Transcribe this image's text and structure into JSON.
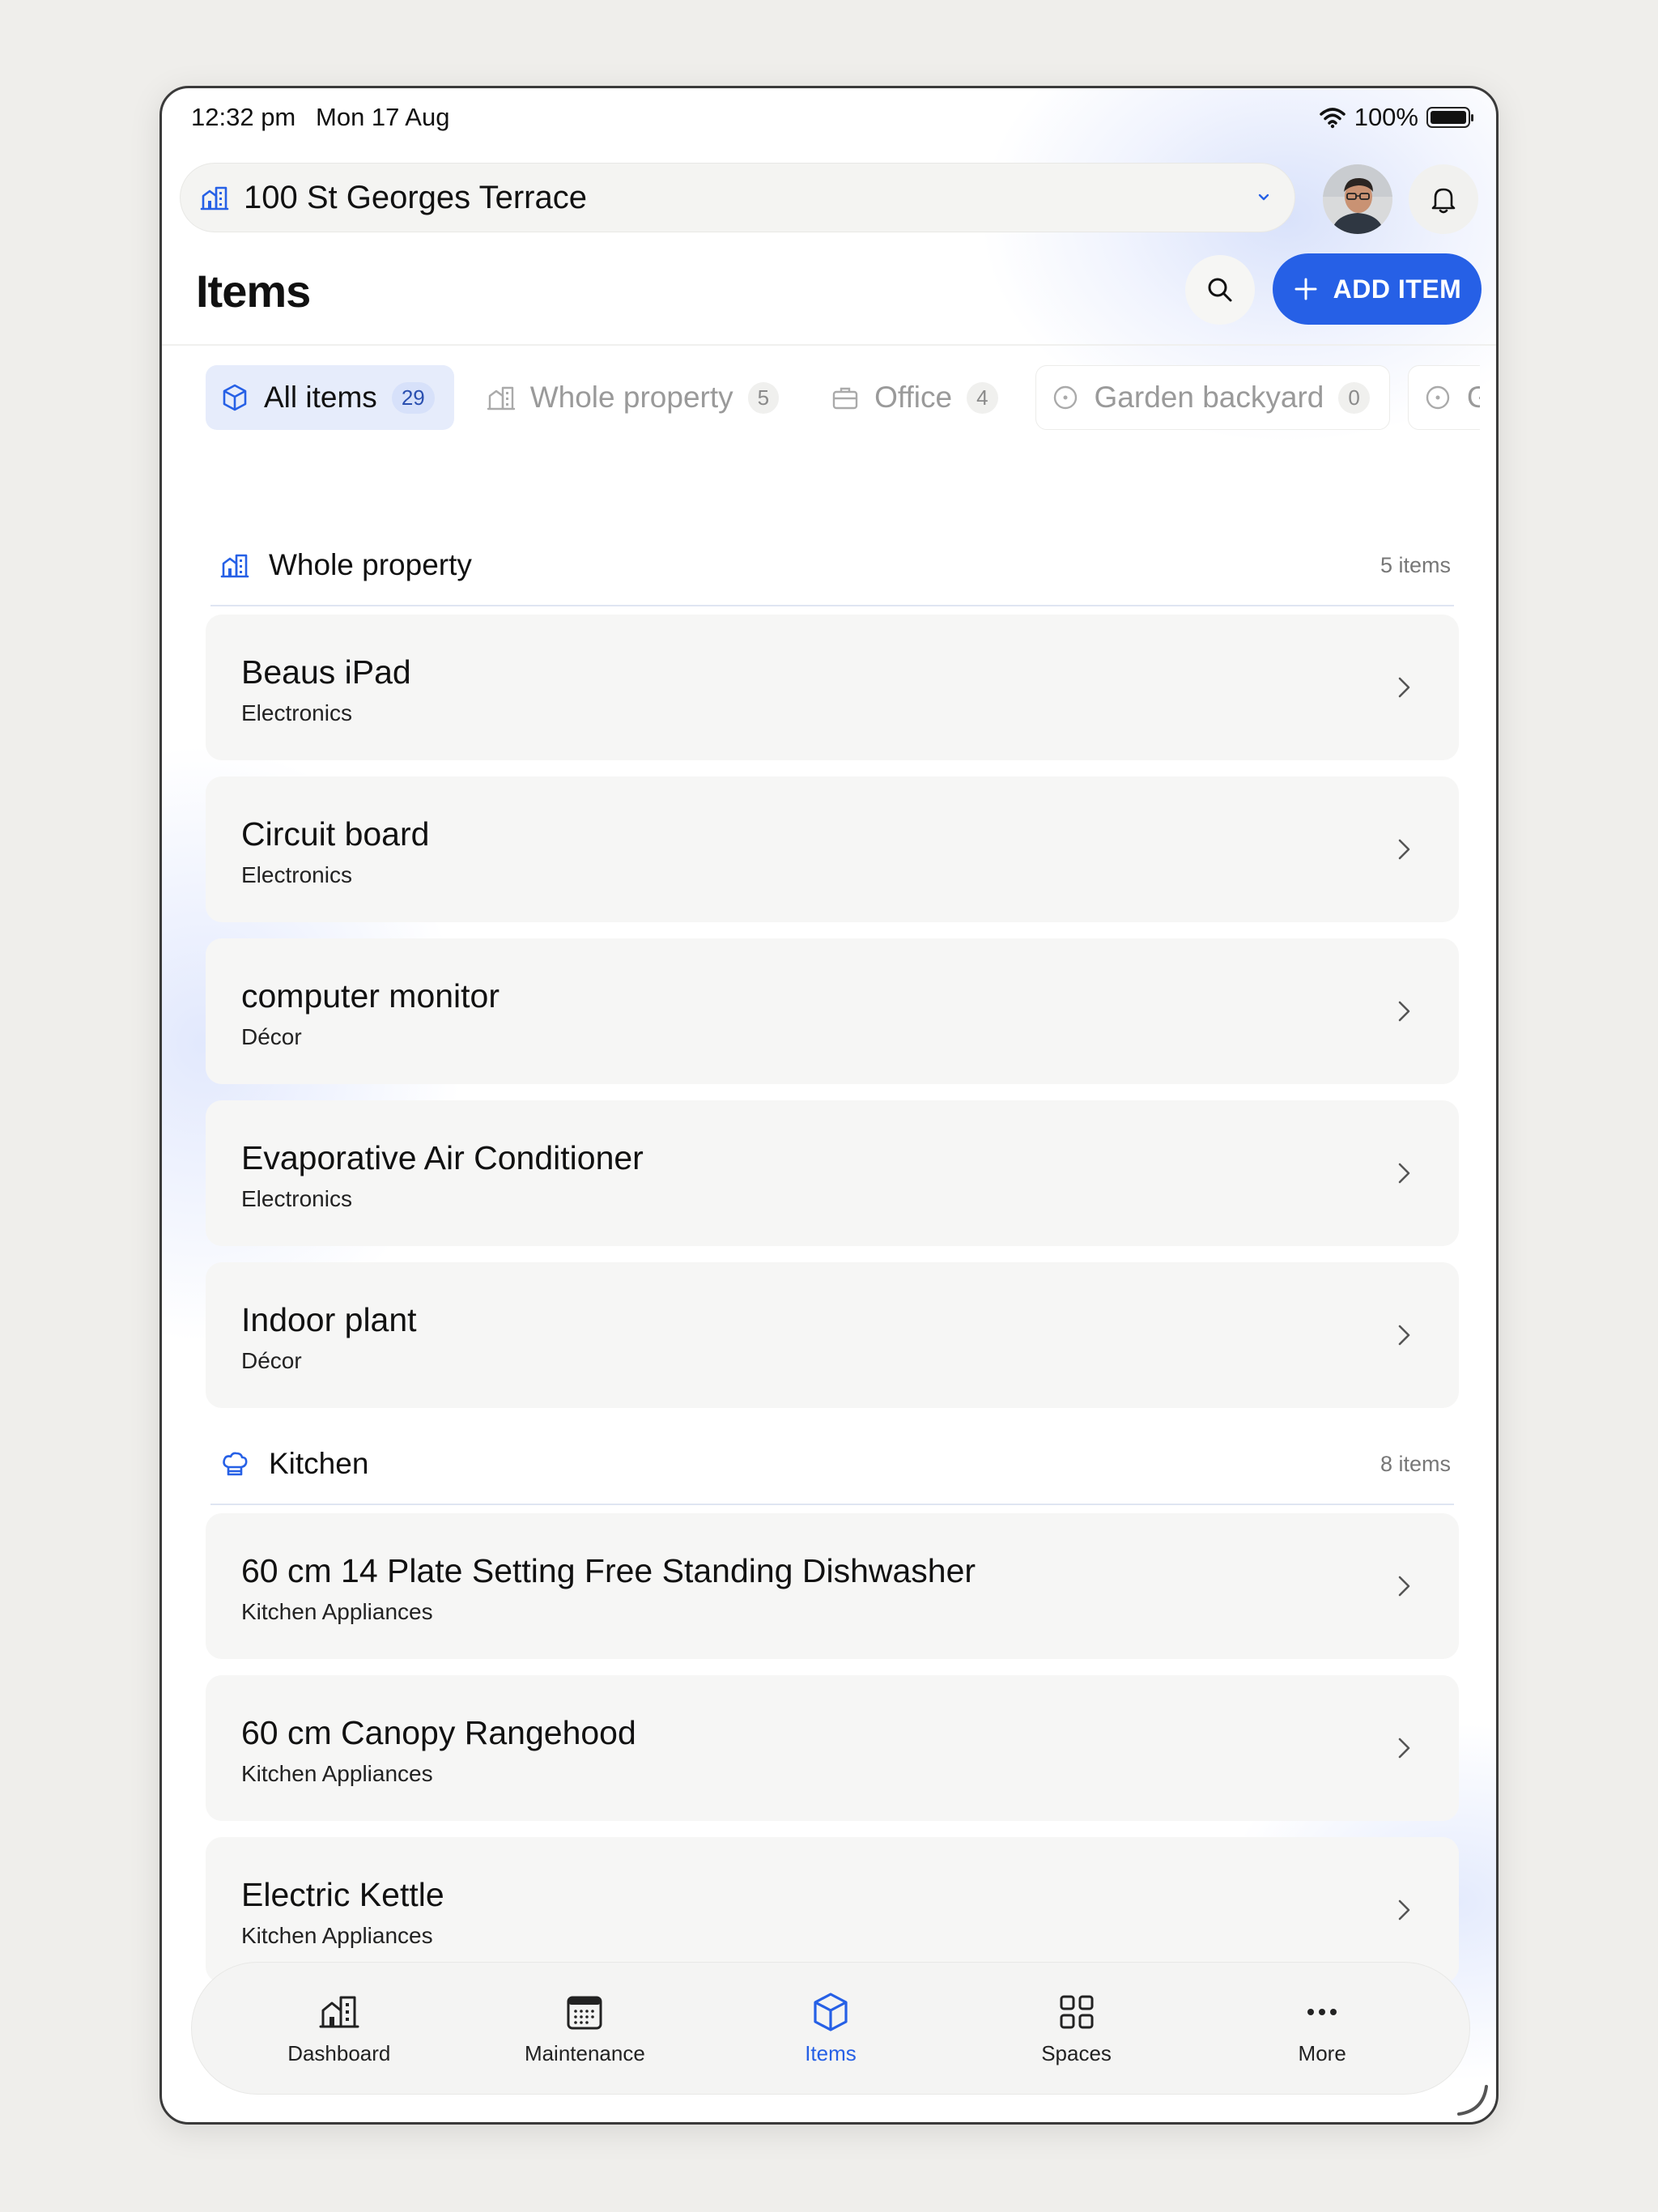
{
  "status_bar": {
    "time": "12:32 pm",
    "date": "Mon 17 Aug",
    "battery": "100%"
  },
  "property": {
    "name": "100 St Georges Terrace"
  },
  "page": {
    "title": "Items",
    "add_label": "ADD ITEM"
  },
  "tabs": [
    {
      "label": "All items",
      "count": "29",
      "active": true
    },
    {
      "label": "Whole property",
      "count": "5",
      "active": false
    },
    {
      "label": "Office",
      "count": "4",
      "active": false
    },
    {
      "label": "Garden backyard",
      "count": "0",
      "active": false
    },
    {
      "label": "Ga",
      "active": false
    }
  ],
  "sections": [
    {
      "title": "Whole property",
      "count": "5 items",
      "icon": "building-icon",
      "items": [
        {
          "name": "Beaus iPad",
          "category": "Electronics"
        },
        {
          "name": "Circuit board",
          "category": "Electronics"
        },
        {
          "name": "computer monitor",
          "category": "Décor"
        },
        {
          "name": "Evaporative Air Conditioner",
          "category": "Electronics"
        },
        {
          "name": "Indoor plant",
          "category": "Décor"
        }
      ]
    },
    {
      "title": "Kitchen",
      "count": "8 items",
      "icon": "chef-hat-icon",
      "items": [
        {
          "name": "60 cm 14 Plate Setting Free Standing Dishwasher",
          "category": "Kitchen Appliances"
        },
        {
          "name": "60 cm Canopy Rangehood",
          "category": "Kitchen Appliances"
        },
        {
          "name": "Electric Kettle",
          "category": "Kitchen Appliances"
        }
      ]
    }
  ],
  "nav": [
    {
      "label": "Dashboard",
      "icon": "dashboard-icon",
      "active": false
    },
    {
      "label": "Maintenance",
      "icon": "calendar-icon",
      "active": false
    },
    {
      "label": "Items",
      "icon": "box-icon",
      "active": true
    },
    {
      "label": "Spaces",
      "icon": "grid-icon",
      "active": false
    },
    {
      "label": "More",
      "icon": "more-icon",
      "active": false
    }
  ],
  "colors": {
    "accent": "#2660e6",
    "active_tab_bg": "#e6ecfb",
    "card_bg": "#f6f6f5"
  }
}
